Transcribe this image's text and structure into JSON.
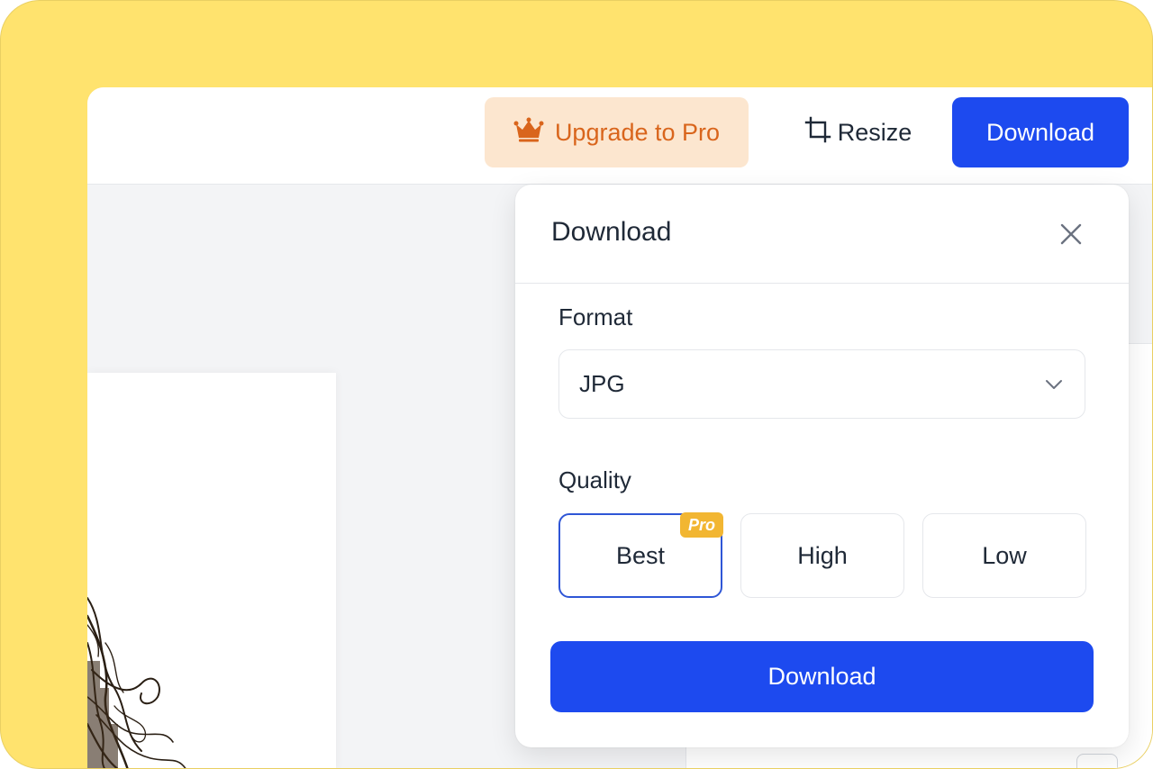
{
  "topbar": {
    "upgrade_label": "Upgrade to Pro",
    "resize_label": "Resize",
    "download_label": "Download"
  },
  "download_popup": {
    "title": "Download",
    "format": {
      "label": "Format",
      "selected": "JPG"
    },
    "quality": {
      "label": "Quality",
      "options": [
        {
          "label": "Best",
          "badge": "Pro",
          "selected": true
        },
        {
          "label": "High",
          "selected": false
        },
        {
          "label": "Low",
          "selected": false
        }
      ]
    },
    "download_button": "Download"
  },
  "colors": {
    "frame_background": "#FFE36E",
    "primary_blue": "#1D4AEF",
    "upgrade_bg": "#FCE6CF",
    "upgrade_text": "#D9651C",
    "pro_badge": "#F2B632",
    "selected_border": "#2F56D6"
  },
  "icons": {
    "upgrade": "crown-icon",
    "resize": "crop-icon",
    "close": "close-icon",
    "select": "chevron-down-icon"
  }
}
